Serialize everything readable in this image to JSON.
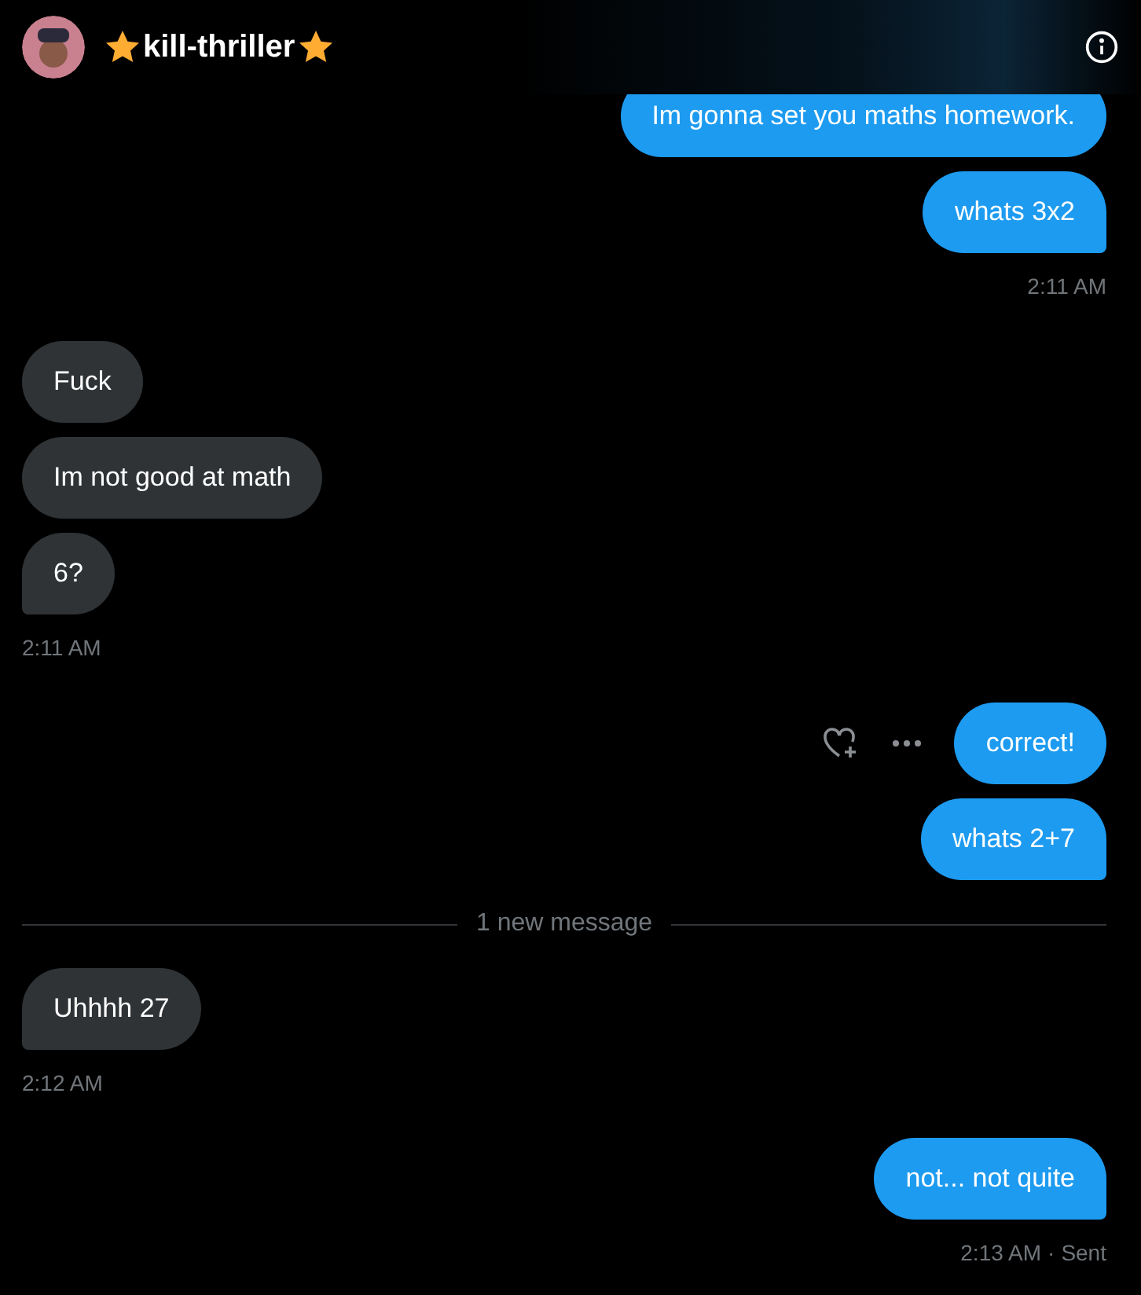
{
  "header": {
    "name": "kill-thriller"
  },
  "groups": [
    {
      "kind": "outgoing",
      "messages": [
        {
          "text": "Im gonna set you maths homework.",
          "actions": false
        },
        {
          "text": "whats 3x2",
          "actions": false
        }
      ],
      "time": "2:11 AM"
    },
    {
      "kind": "incoming",
      "messages": [
        {
          "text": "Fuck",
          "actions": false
        },
        {
          "text": "Im not good at math",
          "actions": false
        },
        {
          "text": "6?",
          "actions": false
        }
      ],
      "time": "2:11 AM"
    },
    {
      "kind": "outgoing",
      "messages": [
        {
          "text": "correct!",
          "actions": true
        },
        {
          "text": "whats 2+7",
          "actions": false
        }
      ]
    },
    {
      "kind": "divider",
      "text": "1 new message"
    },
    {
      "kind": "incoming",
      "messages": [
        {
          "text": "Uhhhh 27",
          "actions": false
        }
      ],
      "time": "2:12 AM"
    },
    {
      "kind": "outgoing",
      "messages": [
        {
          "text": "not... not quite",
          "actions": false
        }
      ],
      "time": "2:13 AM",
      "separator": "·",
      "status": "Sent"
    }
  ]
}
